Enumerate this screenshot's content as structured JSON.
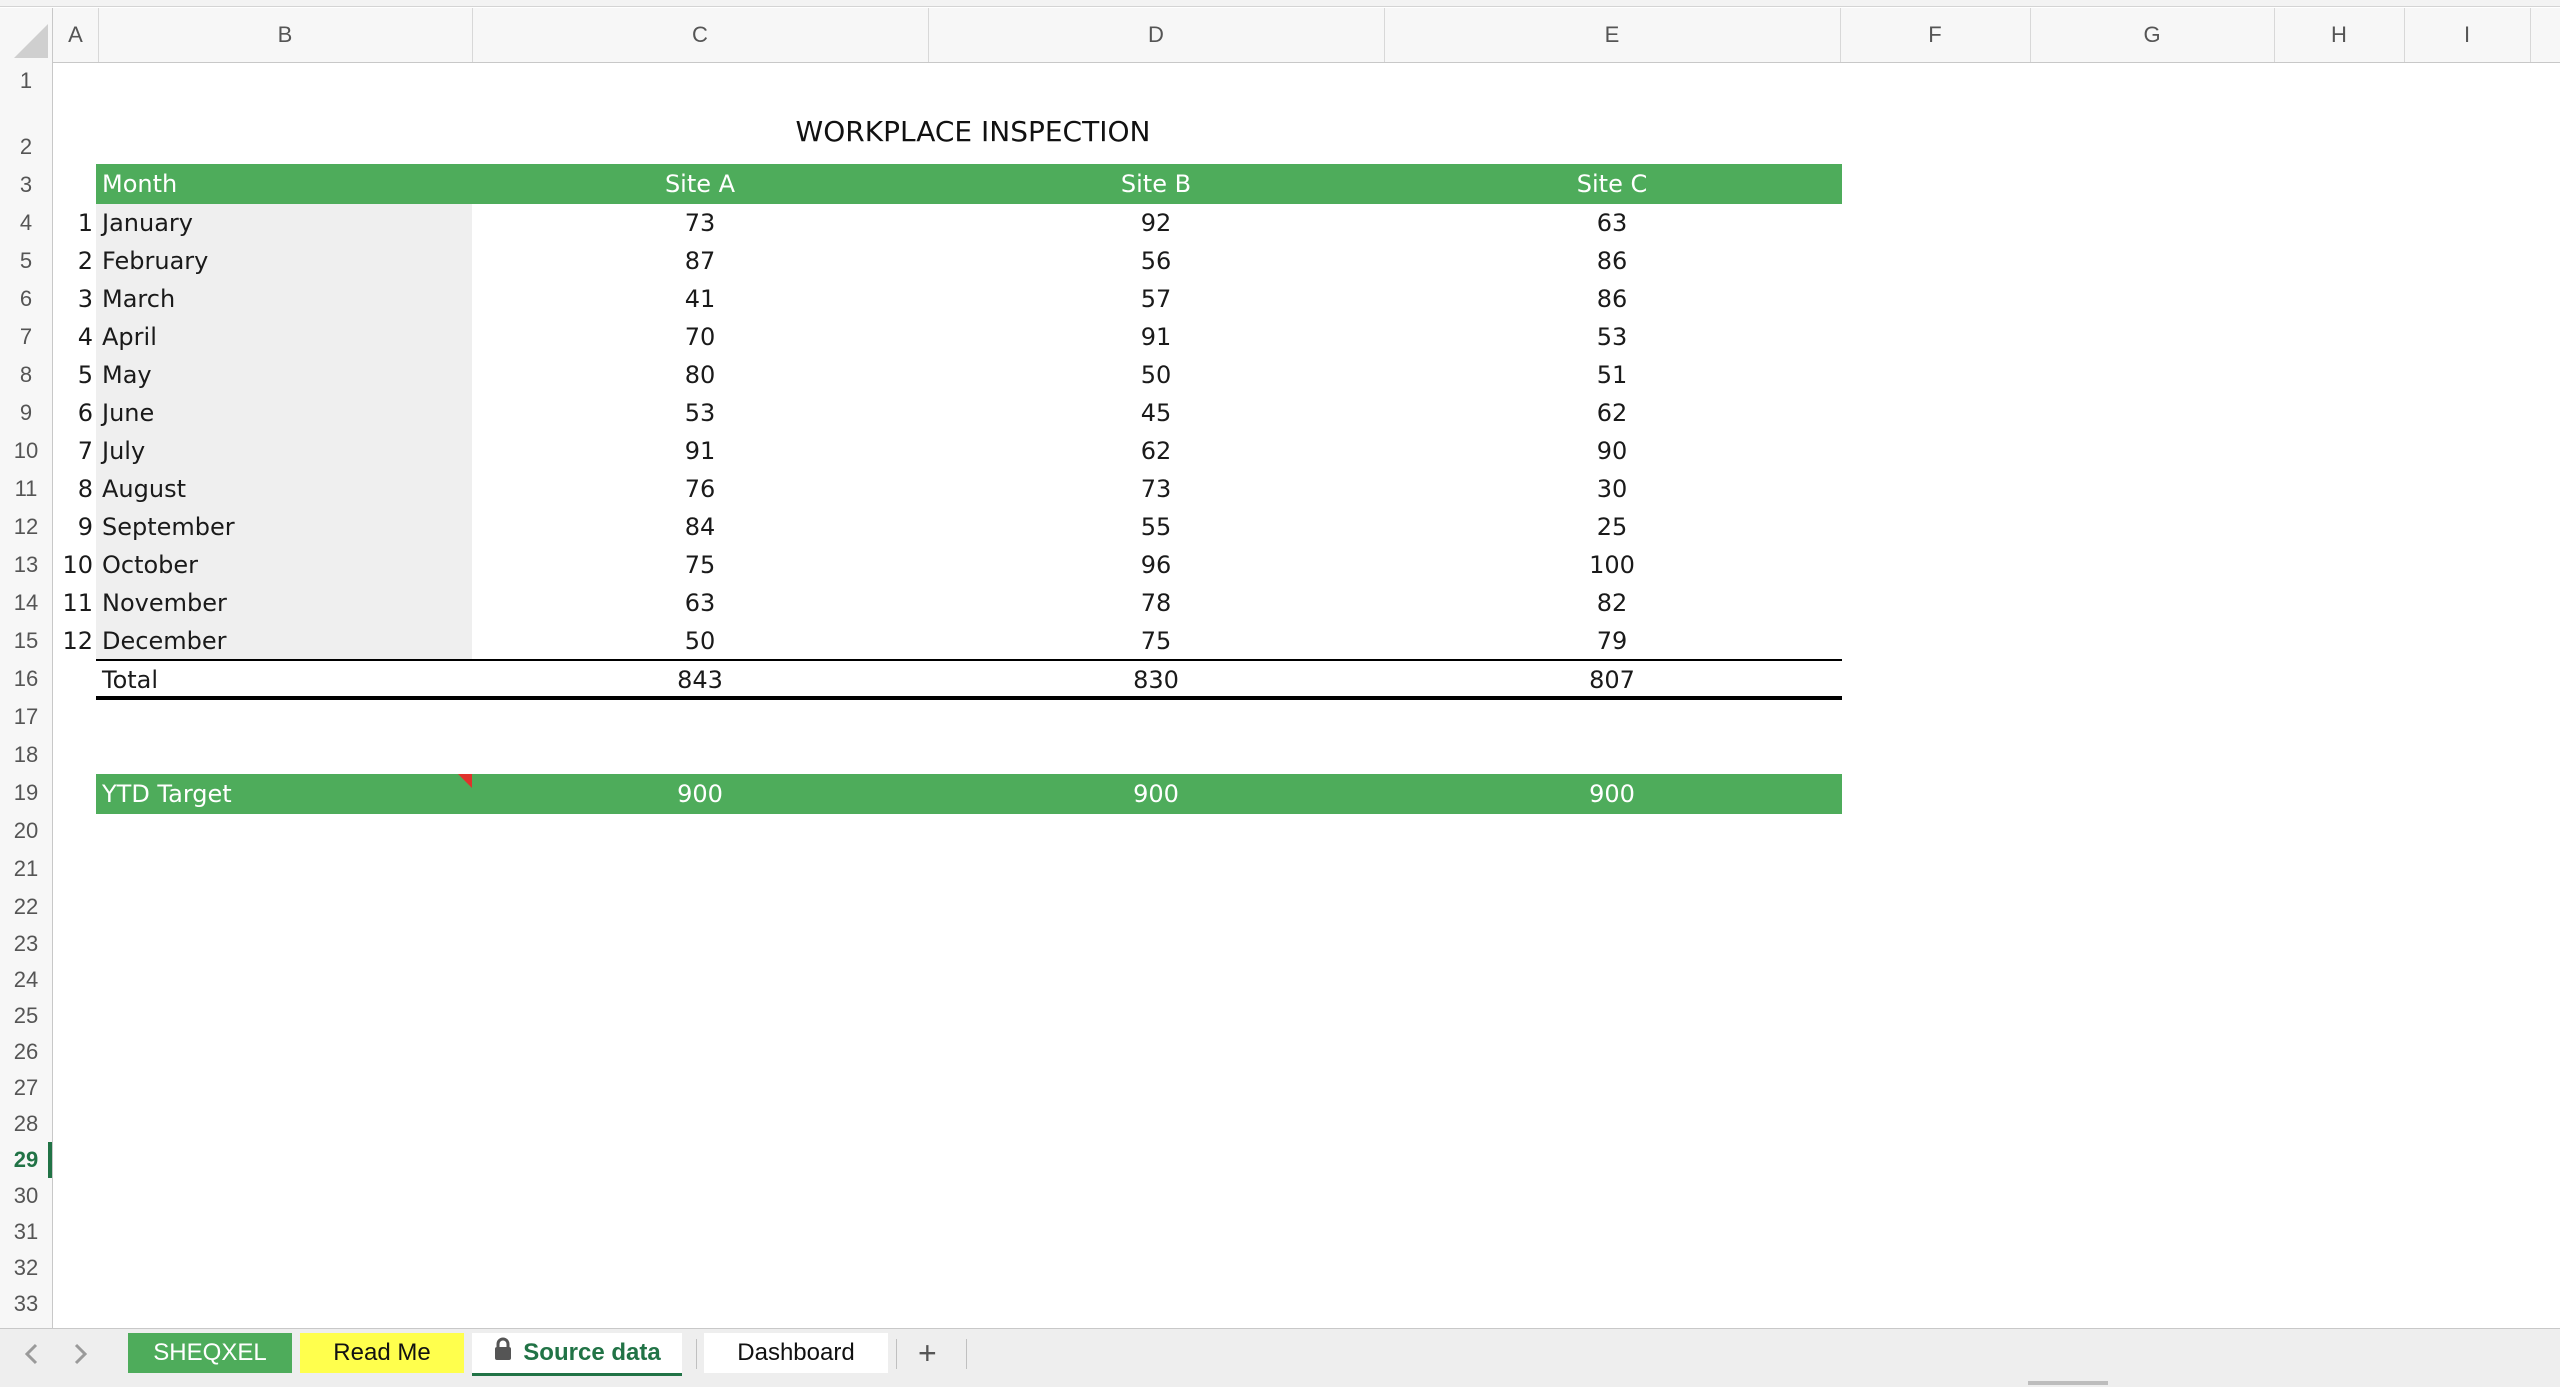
{
  "columns": [
    "A",
    "B",
    "C",
    "D",
    "E",
    "F",
    "G",
    "H",
    "I"
  ],
  "rows": [
    "1",
    "2",
    "3",
    "4",
    "5",
    "6",
    "7",
    "8",
    "9",
    "10",
    "11",
    "12",
    "13",
    "14",
    "15",
    "16",
    "17",
    "18",
    "19",
    "20",
    "21",
    "22",
    "23",
    "24",
    "25",
    "26",
    "27",
    "28",
    "29",
    "30",
    "31",
    "32",
    "33"
  ],
  "active_row": "29",
  "sheet_title": "WORKPLACE INSPECTION",
  "table": {
    "headers": [
      "Month",
      "Site A",
      "Site B",
      "Site C"
    ],
    "rows": [
      {
        "n": "1",
        "month": "January",
        "a": "73",
        "b": "92",
        "c": "63"
      },
      {
        "n": "2",
        "month": "February",
        "a": "87",
        "b": "56",
        "c": "86"
      },
      {
        "n": "3",
        "month": "March",
        "a": "41",
        "b": "57",
        "c": "86"
      },
      {
        "n": "4",
        "month": "April",
        "a": "70",
        "b": "91",
        "c": "53"
      },
      {
        "n": "5",
        "month": "May",
        "a": "80",
        "b": "50",
        "c": "51"
      },
      {
        "n": "6",
        "month": "June",
        "a": "53",
        "b": "45",
        "c": "62"
      },
      {
        "n": "7",
        "month": "July",
        "a": "91",
        "b": "62",
        "c": "90"
      },
      {
        "n": "8",
        "month": "August",
        "a": "76",
        "b": "73",
        "c": "30"
      },
      {
        "n": "9",
        "month": "September",
        "a": "84",
        "b": "55",
        "c": "25"
      },
      {
        "n": "10",
        "month": "October",
        "a": "75",
        "b": "96",
        "c": "100"
      },
      {
        "n": "11",
        "month": "November",
        "a": "63",
        "b": "78",
        "c": "82"
      },
      {
        "n": "12",
        "month": "December",
        "a": "50",
        "b": "75",
        "c": "79"
      }
    ],
    "total": {
      "label": "Total",
      "a": "843",
      "b": "830",
      "c": "807"
    },
    "target": {
      "label": "YTD Target",
      "a": "900",
      "b": "900",
      "c": "900"
    }
  },
  "tabs": {
    "prev_icon": "chevron-left-icon",
    "next_icon": "chevron-right-icon",
    "sheqxel": "SHEQXEL",
    "readme": "Read Me",
    "source": "Source data",
    "dashboard": "Dashboard",
    "add": "+"
  },
  "colors": {
    "accent_green": "#4eac5b",
    "excel_green": "#217346",
    "readme_yellow": "#ffff4d",
    "comment_red": "#e0322c"
  }
}
